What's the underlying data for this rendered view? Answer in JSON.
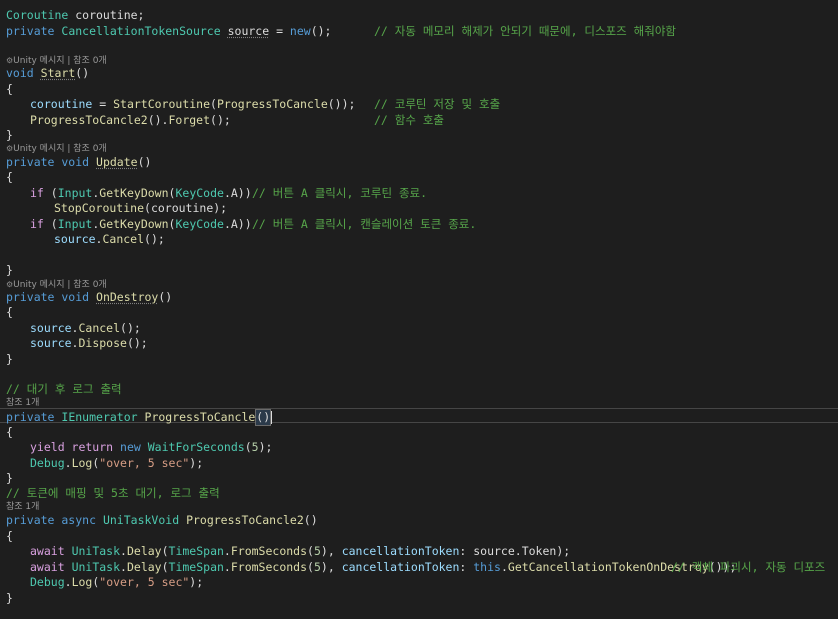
{
  "editor": {
    "l1": {
      "t1": "Coroutine",
      "t2": " coroutine;"
    },
    "l2": {
      "kw": "private",
      "t1": "CancellationTokenSource",
      "t2": "source",
      "t3": " = ",
      "t4": "new",
      "t5": "();",
      "cm": "// 자동 메모리 해제가 안되기 때문에, 디스포즈 해줘야함"
    },
    "hint_start": {
      "icon": "⚙",
      "text": "Unity 메시지 | 참조 0개"
    },
    "l_start": {
      "kw": "void",
      "fn": "Start",
      "t": "()"
    },
    "brace_open": "{",
    "brace_close": "}",
    "l_co": {
      "v": "coroutine",
      "t1": " = ",
      "fn": "StartCoroutine",
      "t2": "(",
      "fn2": "ProgressToCancle",
      "t3": "());",
      "cm": "// 코루틴 저장 및 호출"
    },
    "l_p2": {
      "fn": "ProgressToCancle2",
      "t1": "().",
      "fn2": "Forget",
      "t2": "();",
      "cm": "// 함수 호출"
    },
    "hint_update": {
      "icon": "⚙",
      "text": "Unity 메시지 | 참조 0개"
    },
    "l_update": {
      "kw": "private void",
      "fn": "Update",
      "t": "()"
    },
    "l_if1": {
      "kw": "if",
      "t1": " (",
      "ty": "Input",
      "t2": ".",
      "fn": "GetKeyDown",
      "t3": "(",
      "ty2": "KeyCode",
      "t4": ".A))",
      "cm": "// 버튼 A 클릭시, 코루틴 종료."
    },
    "l_stop": {
      "fn": "StopCoroutine",
      "t": "(coroutine);"
    },
    "l_if2": {
      "kw": "if",
      "t1": " (",
      "ty": "Input",
      "t2": ".",
      "fn": "GetKeyDown",
      "t3": "(",
      "ty2": "KeyCode",
      "t4": ".A))",
      "cm": "// 버튼 A 클릭시, 캔슬레이션 토큰 종료."
    },
    "l_cancel": {
      "v": "source",
      "t1": ".",
      "fn": "Cancel",
      "t2": "();"
    },
    "hint_destroy": {
      "icon": "⚙",
      "text": "Unity 메시지 | 참조 0개"
    },
    "l_destroy": {
      "kw": "private void",
      "fn": "OnDestroy",
      "t": "()"
    },
    "l_cancel2": {
      "v": "source",
      "t1": ".",
      "fn": "Cancel",
      "t2": "();"
    },
    "l_dispose": {
      "v": "source",
      "t1": ".",
      "fn": "Dispose",
      "t2": "();"
    },
    "cm_wait": "// 대기 후 로그 출력",
    "hint_ref1": "참조 1개",
    "l_ienum": {
      "kw": "private",
      "ty": "IEnumerator",
      "fn": "ProgressToCancle",
      "t1": "(",
      "t2": ")"
    },
    "l_yield": {
      "kw": "yield return",
      "kw2": "new",
      "ty": "WaitForSeconds",
      "t1": "(",
      "num": "5",
      "t2": ");"
    },
    "l_log1": {
      "ty": "Debug",
      "t1": ".",
      "fn": "Log",
      "t2": "(",
      "str": "\"over, 5 sec\"",
      "t3": ");"
    },
    "cm_token": "// 토큰에 매핑 및 5초 대기, 로그 출력",
    "hint_ref2": "참조 1개",
    "l_async": {
      "kw": "private async",
      "ty": "UniTaskVoid",
      "fn": "ProgressToCancle2",
      "t": "()"
    },
    "l_await1": {
      "kw": "await",
      "ty": "UniTask",
      "t1": ".",
      "fn": "Delay",
      "t2": "(",
      "ty2": "TimeSpan",
      "t3": ".",
      "fn2": "FromSeconds",
      "t4": "(",
      "num": "5",
      "t5": "), ",
      "p": "cancellationToken",
      "t6": ": source.Token);"
    },
    "l_await2": {
      "kw": "await",
      "ty": "UniTask",
      "t1": ".",
      "fn": "Delay",
      "t2": "(",
      "ty2": "TimeSpan",
      "t3": ".",
      "fn2": "FromSeconds",
      "t4": "(",
      "num": "5",
      "t5": "), ",
      "p": "cancellationToken",
      "t6": ": ",
      "kw2": "this",
      "t7": ".",
      "fn3": "GetCancellationTokenOnDestroy",
      "t8": "());",
      "cm": "// 객체 파괴시, 자동 디포즈"
    },
    "l_log2": {
      "ty": "Debug",
      "t1": ".",
      "fn": "Log",
      "t2": "(",
      "str": "\"over, 5 sec\"",
      "t3": ");"
    }
  }
}
